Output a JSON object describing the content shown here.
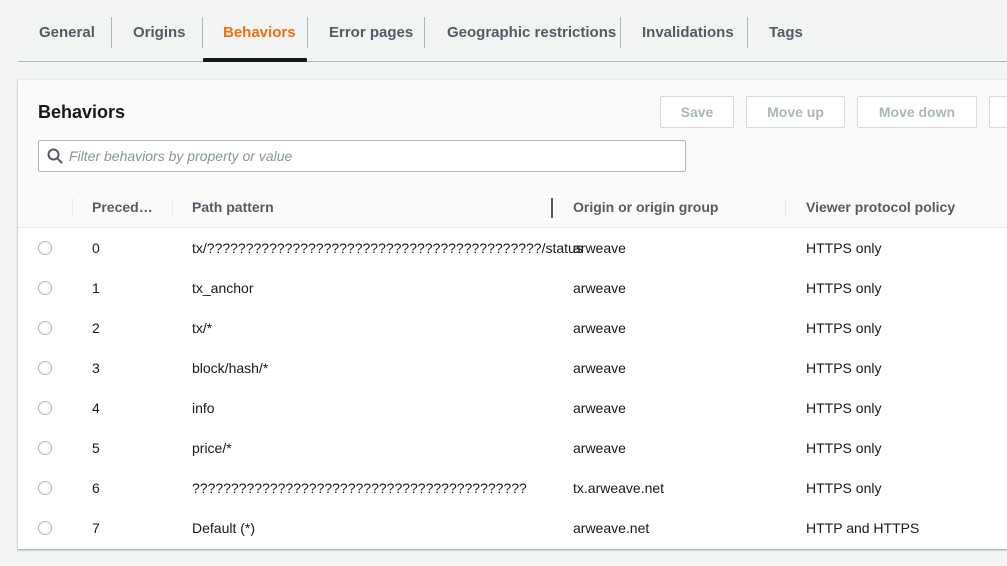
{
  "tabs": {
    "items": [
      {
        "label": "General"
      },
      {
        "label": "Origins"
      },
      {
        "label": "Behaviors"
      },
      {
        "label": "Error pages"
      },
      {
        "label": "Geographic restrictions"
      },
      {
        "label": "Invalidations"
      },
      {
        "label": "Tags"
      }
    ],
    "active": "Behaviors"
  },
  "panel": {
    "title": "Behaviors",
    "buttons": {
      "save": "Save",
      "move_up": "Move up",
      "move_down": "Move down"
    },
    "search": {
      "placeholder": "Filter behaviors by property or value",
      "value": ""
    }
  },
  "table": {
    "columns": [
      "Preced…",
      "Path pattern",
      "Origin or origin group",
      "Viewer protocol policy"
    ],
    "rows": [
      {
        "precedence": "0",
        "path": "tx/???????????????????????????????????????????/status",
        "origin": "arweave",
        "policy": "HTTPS only"
      },
      {
        "precedence": "1",
        "path": "tx_anchor",
        "origin": "arweave",
        "policy": "HTTPS only"
      },
      {
        "precedence": "2",
        "path": "tx/*",
        "origin": "arweave",
        "policy": "HTTPS only"
      },
      {
        "precedence": "3",
        "path": "block/hash/*",
        "origin": "arweave",
        "policy": "HTTPS only"
      },
      {
        "precedence": "4",
        "path": "info",
        "origin": "arweave",
        "policy": "HTTPS only"
      },
      {
        "precedence": "5",
        "path": "price/*",
        "origin": "arweave",
        "policy": "HTTPS only"
      },
      {
        "precedence": "6",
        "path": "???????????????????????????????????????????",
        "origin": "tx.arweave.net",
        "policy": "HTTPS only"
      },
      {
        "precedence": "7",
        "path": "Default (*)",
        "origin": "arweave.net",
        "policy": "HTTP and HTTPS"
      }
    ]
  },
  "colors": {
    "accent": "#ec7211",
    "text": "#16191f",
    "muted": "#545b64",
    "border": "#aab7b8"
  }
}
